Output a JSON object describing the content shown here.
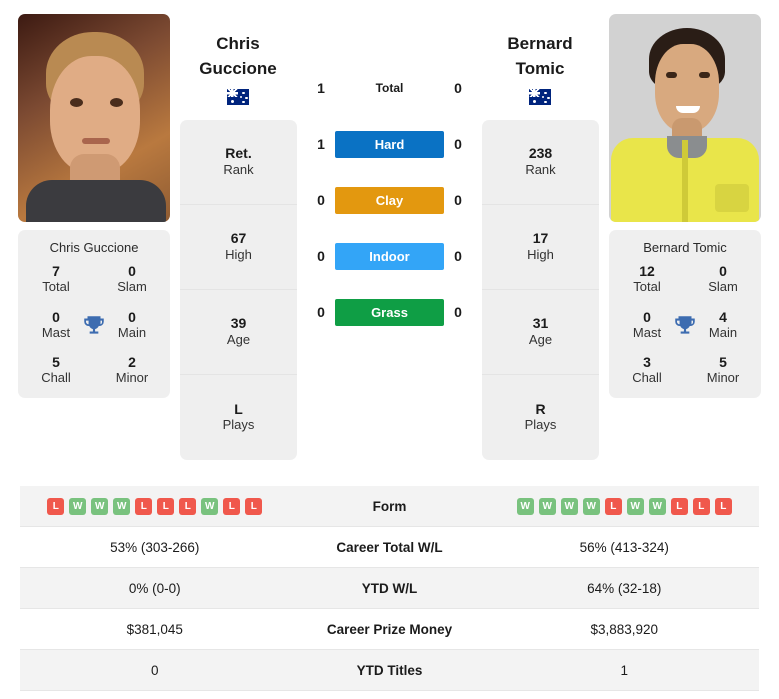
{
  "players": {
    "left": {
      "name_line1": "Chris",
      "name_line2": "Guccione",
      "full_name": "Chris Guccione",
      "country": "Australia",
      "flag": "australia-flag",
      "photo_alt": "Chris Guccione portrait",
      "info": [
        {
          "value": "Ret.",
          "label": "Rank"
        },
        {
          "value": "67",
          "label": "High"
        },
        {
          "value": "39",
          "label": "Age"
        },
        {
          "value": "L",
          "label": "Plays"
        }
      ],
      "titles": [
        {
          "value": "7",
          "label": "Total"
        },
        {
          "value": "0",
          "label": "Slam"
        },
        {
          "value": "0",
          "label": "Mast"
        },
        {
          "value": "0",
          "label": "Main"
        },
        {
          "value": "5",
          "label": "Chall"
        },
        {
          "value": "2",
          "label": "Minor"
        }
      ],
      "form": [
        "L",
        "W",
        "W",
        "W",
        "L",
        "L",
        "L",
        "W",
        "L",
        "L"
      ],
      "career_total_wl": "53% (303-266)",
      "ytd_wl": "0% (0-0)",
      "career_prize_money": "$381,045",
      "ytd_titles": "0"
    },
    "right": {
      "name_line1": "Bernard",
      "name_line2": "Tomic",
      "full_name": "Bernard Tomic",
      "country": "Australia",
      "flag": "australia-flag",
      "photo_alt": "Bernard Tomic portrait",
      "info": [
        {
          "value": "238",
          "label": "Rank"
        },
        {
          "value": "17",
          "label": "High"
        },
        {
          "value": "31",
          "label": "Age"
        },
        {
          "value": "R",
          "label": "Plays"
        }
      ],
      "titles": [
        {
          "value": "12",
          "label": "Total"
        },
        {
          "value": "0",
          "label": "Slam"
        },
        {
          "value": "0",
          "label": "Mast"
        },
        {
          "value": "4",
          "label": "Main"
        },
        {
          "value": "3",
          "label": "Chall"
        },
        {
          "value": "5",
          "label": "Minor"
        }
      ],
      "form": [
        "W",
        "W",
        "W",
        "W",
        "L",
        "W",
        "W",
        "L",
        "L",
        "L"
      ],
      "career_total_wl": "56% (413-324)",
      "ytd_wl": "64% (32-18)",
      "career_prize_money": "$3,883,920",
      "ytd_titles": "1"
    }
  },
  "h2h": [
    {
      "label": "Total",
      "left": "1",
      "right": "0",
      "style": "plain",
      "color": ""
    },
    {
      "label": "Hard",
      "left": "1",
      "right": "0",
      "style": "badge",
      "color": "#0a72c4"
    },
    {
      "label": "Clay",
      "left": "0",
      "right": "0",
      "style": "badge",
      "color": "#e3980f"
    },
    {
      "label": "Indoor",
      "left": "0",
      "right": "0",
      "style": "badge",
      "color": "#33a5f7"
    },
    {
      "label": "Grass",
      "left": "0",
      "right": "0",
      "style": "badge",
      "color": "#0f9e45"
    }
  ],
  "table_rows": [
    {
      "label": "Form",
      "type": "form",
      "left": "",
      "right": ""
    },
    {
      "label": "Career Total W/L",
      "type": "text",
      "left": "53% (303-266)",
      "right": "56% (413-324)"
    },
    {
      "label": "YTD W/L",
      "type": "text",
      "left": "0% (0-0)",
      "right": "64% (32-18)"
    },
    {
      "label": "Career Prize Money",
      "type": "text",
      "left": "$381,045",
      "right": "$3,883,920"
    },
    {
      "label": "YTD Titles",
      "type": "text",
      "left": "0",
      "right": "1"
    }
  ],
  "icons": {
    "trophy": "trophy-icon"
  },
  "colors": {
    "card_bg": "#efefef",
    "win": "#79c27e",
    "loss": "#f0584c",
    "trophy": "#3d6cb0"
  }
}
